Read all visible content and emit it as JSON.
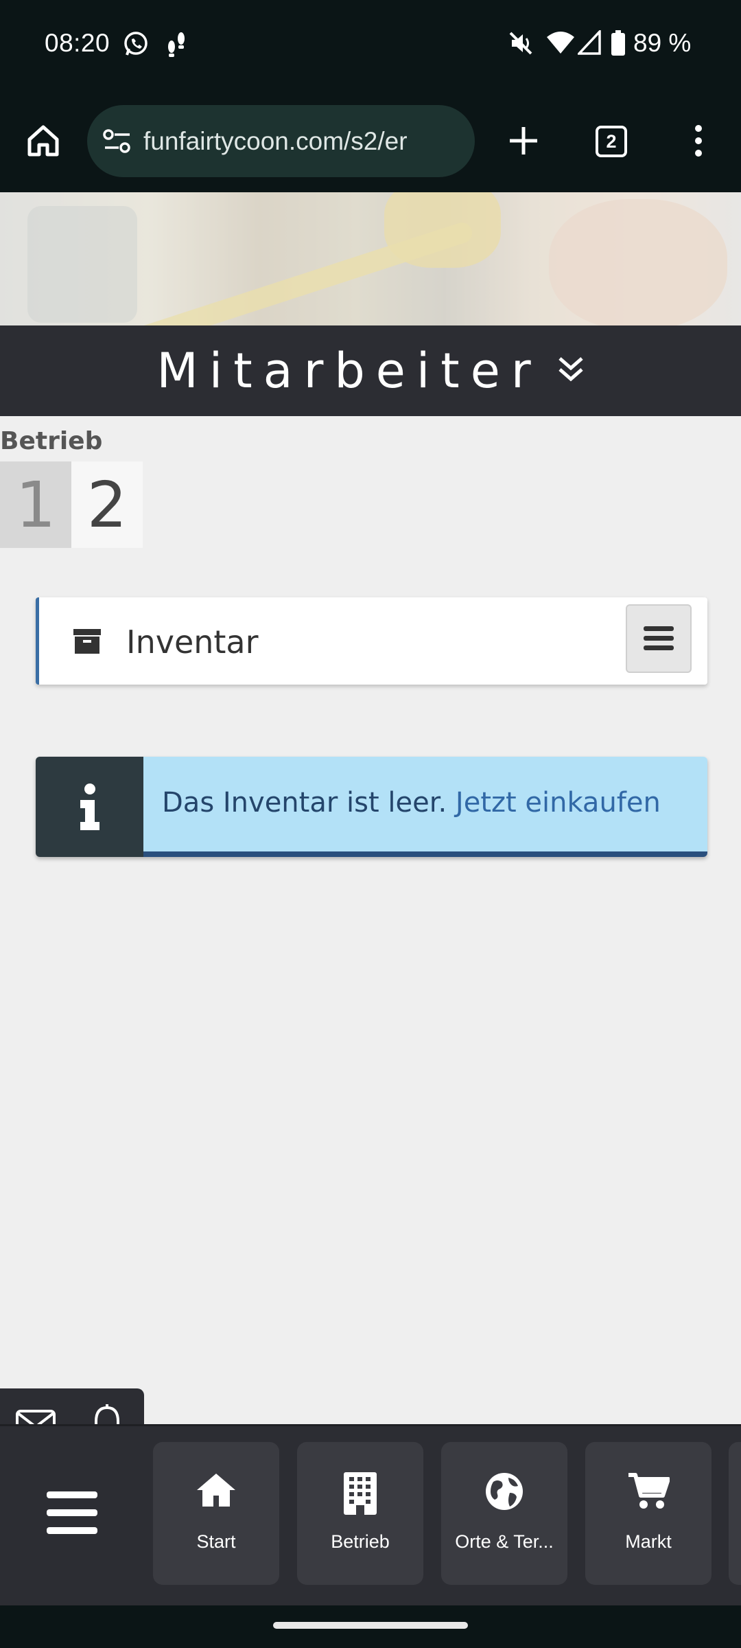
{
  "status_bar": {
    "time": "08:20",
    "battery": "89 %",
    "icons": [
      "whatsapp-icon",
      "footsteps-icon",
      "mute-icon",
      "wifi-icon",
      "signal-icon",
      "battery-icon"
    ]
  },
  "browser": {
    "url": "funfairtycoon.com/s2/er",
    "tab_count": "2"
  },
  "section": {
    "title": "Mitarbeiter"
  },
  "betrieb": {
    "label": "Betrieb",
    "pages": [
      "1",
      "2"
    ]
  },
  "inventory": {
    "title": "Inventar"
  },
  "info": {
    "message": "Das Inventar ist leer.",
    "link": "Jetzt einkaufen"
  },
  "bottom_nav": {
    "items": [
      {
        "label": "Start",
        "icon": "home-icon"
      },
      {
        "label": "Betrieb",
        "icon": "building-icon"
      },
      {
        "label": "Orte & Ter...",
        "icon": "globe-icon"
      },
      {
        "label": "Markt",
        "icon": "cart-icon"
      }
    ]
  },
  "colors": {
    "header_bg": "#2c2d33",
    "info_bg": "#b3e1f7",
    "accent_blue": "#3a6ea5"
  }
}
